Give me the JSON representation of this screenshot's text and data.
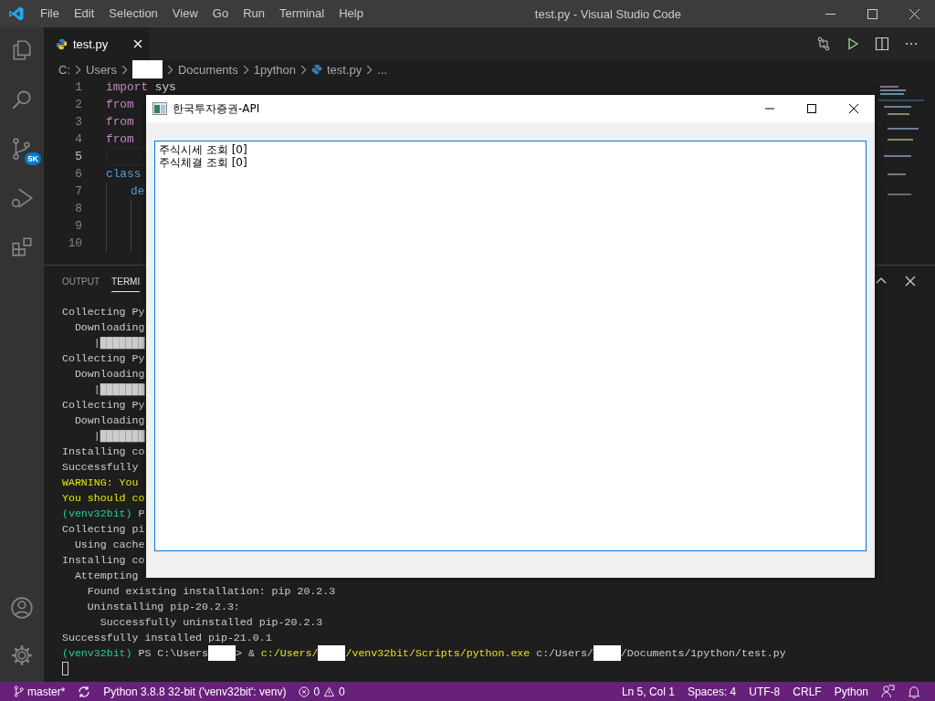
{
  "window": {
    "title": "test.py - Visual Studio Code"
  },
  "menu": [
    "File",
    "Edit",
    "Selection",
    "View",
    "Go",
    "Run",
    "Terminal",
    "Help"
  ],
  "activity_bar": {
    "source_control_badge": "5K"
  },
  "editor_tabs": [
    {
      "label": "test.py",
      "selected": true
    }
  ],
  "breadcrumbs": [
    {
      "kind": "text",
      "text": "C:"
    },
    {
      "kind": "text",
      "text": "Users"
    },
    {
      "kind": "redacted"
    },
    {
      "kind": "text",
      "text": "Documents"
    },
    {
      "kind": "text",
      "text": "1python"
    },
    {
      "kind": "file",
      "text": "test.py"
    },
    {
      "kind": "text",
      "text": "..."
    }
  ],
  "code_lines": [
    {
      "number": "1",
      "current": false,
      "tokens": [
        {
          "kind": "keyword",
          "text": "import"
        },
        {
          "kind": "plain",
          "text": "sys"
        }
      ]
    },
    {
      "number": "2",
      "current": false,
      "tokens": [
        {
          "kind": "keyword",
          "text": "from"
        }
      ]
    },
    {
      "number": "3",
      "current": false,
      "tokens": [
        {
          "kind": "keyword",
          "text": "from"
        }
      ]
    },
    {
      "number": "4",
      "current": false,
      "tokens": [
        {
          "kind": "keyword",
          "text": "from"
        }
      ]
    },
    {
      "number": "5",
      "current": true
    },
    {
      "number": "6",
      "current": false,
      "tokens": [
        {
          "kind": "storage",
          "text": "class"
        }
      ],
      "children": [
        {
          "number": "7",
          "current": false,
          "tokens": [
            {
              "kind": "storage",
              "text": "de"
            }
          ],
          "children": [
            {
              "number": "8",
              "current": false
            },
            {
              "number": "9",
              "current": false
            },
            {
              "number": "10",
              "current": false
            }
          ]
        }
      ]
    }
  ],
  "panel_tabs": [
    {
      "label": "OUTPUT",
      "selected": false
    },
    {
      "label": "TERMI",
      "selected": true
    }
  ],
  "terminal_lines": [
    [
      {
        "kind": "plain",
        "text": "Collecting Py"
      }
    ],
    [
      {
        "kind": "plain",
        "text": "  Downloading"
      }
    ],
    [
      {
        "kind": "plain",
        "text": "     |███████"
      }
    ],
    [
      {
        "kind": "plain",
        "text": "Collecting Py"
      }
    ],
    [
      {
        "kind": "plain",
        "text": "  Downloading"
      }
    ],
    [
      {
        "kind": "plain",
        "text": "     |███████"
      }
    ],
    [
      {
        "kind": "plain",
        "text": "Collecting Py"
      }
    ],
    [
      {
        "kind": "plain",
        "text": "  Downloading"
      }
    ],
    [
      {
        "kind": "plain",
        "text": "     |███████"
      }
    ],
    [
      {
        "kind": "plain",
        "text": "Installing co"
      }
    ],
    [
      {
        "kind": "plain",
        "text": "Successfully"
      }
    ],
    [
      {
        "kind": "warning",
        "text": "WARNING: You"
      }
    ],
    [
      {
        "kind": "warning",
        "text": "You should co"
      }
    ],
    [
      {
        "kind": "venv",
        "text": "(venv32bit)"
      },
      {
        "kind": "plain",
        "text": " P"
      }
    ],
    [
      {
        "kind": "plain",
        "text": "Collecting pi"
      }
    ],
    [
      {
        "kind": "plain",
        "text": "  Using cache"
      }
    ],
    [
      {
        "kind": "plain",
        "text": "Installing co"
      }
    ],
    [
      {
        "kind": "plain",
        "text": "  Attempting"
      }
    ],
    [
      {
        "kind": "plain",
        "text": "    Found existing installation: pip 20.2.3"
      }
    ],
    [
      {
        "kind": "plain",
        "text": "    Uninstalling pip-20.2.3:"
      }
    ],
    [
      {
        "kind": "plain",
        "text": "      Successfully uninstalled pip-20.2.3"
      }
    ],
    [
      {
        "kind": "plain",
        "text": "Successfully installed pip-21.0.1"
      }
    ],
    [
      {
        "kind": "venv",
        "text": "(venv32bit)"
      },
      {
        "kind": "plain",
        "text": " PS C:\\Users"
      },
      {
        "kind": "redacted"
      },
      {
        "kind": "plain",
        "text": "> &"
      },
      {
        "kind": "command",
        "text": " c:/Users/"
      },
      {
        "kind": "redacted"
      },
      {
        "kind": "command",
        "text": "/venv32bit/Scripts/python.exe"
      },
      {
        "kind": "plain",
        "text": " c:/Users/"
      },
      {
        "kind": "redacted"
      },
      {
        "kind": "plain",
        "text": "/Documents/1python/test.py"
      }
    ],
    [
      {
        "kind": "cursor"
      }
    ]
  ],
  "status_bar": {
    "left": [
      {
        "kind": "branch",
        "text": "master*"
      },
      {
        "kind": "sync"
      },
      {
        "kind": "text",
        "text": "Python 3.8.8 32-bit ('venv32bit': venv)"
      },
      {
        "kind": "problems",
        "errors": "0",
        "warnings": "0"
      }
    ],
    "right": [
      {
        "kind": "text",
        "text": "Ln 5, Col 1"
      },
      {
        "kind": "text",
        "text": "Spaces: 4"
      },
      {
        "kind": "text",
        "text": "UTF-8"
      },
      {
        "kind": "text",
        "text": "CRLF"
      },
      {
        "kind": "text",
        "text": "Python"
      },
      {
        "kind": "feedback"
      },
      {
        "kind": "bell"
      }
    ]
  },
  "dialog": {
    "title": "한국투자증권-API",
    "list_items": [
      "주식시세 조회 [0]",
      "주식체결 조회 [0]"
    ]
  }
}
